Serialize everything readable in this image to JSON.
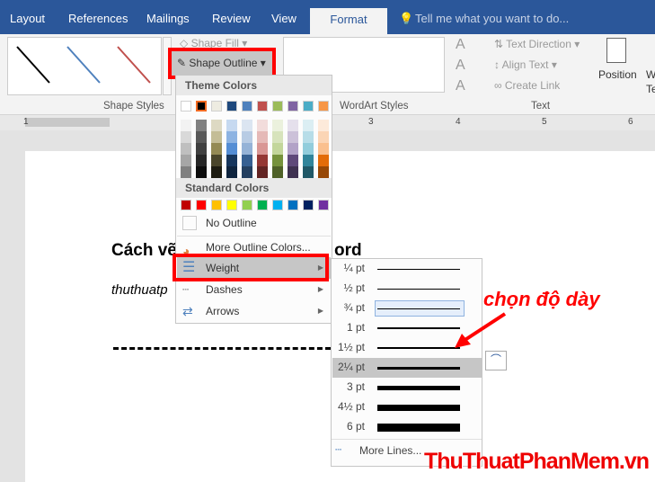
{
  "tabs": [
    "Layout",
    "References",
    "Mailings",
    "Review",
    "View",
    "Format"
  ],
  "tell_me": "Tell me what you want to do...",
  "ribbon": {
    "shape_fill": "Shape Fill",
    "shape_outline": "Shape Outline",
    "shape_styles": "Shape Styles",
    "wordart_styles": "WordArt Styles",
    "text_direction": "Text Direction",
    "align_text": "Align Text",
    "create_link": "Create Link",
    "text_group": "Text",
    "position": "Position",
    "wrap": "W",
    "wrap2": "Te"
  },
  "ruler": [
    "1",
    "3",
    "4",
    "5",
    "6"
  ],
  "document": {
    "heading_start": "Cách vẽ",
    "heading_end": "ord",
    "subtitle": "thuthuatp"
  },
  "menu": {
    "theme_colors": "Theme Colors",
    "standard_colors": "Standard Colors",
    "no_outline": "No Outline",
    "more_colors": "More Outline Colors...",
    "weight": "Weight",
    "dashes": "Dashes",
    "arrows": "Arrows"
  },
  "theme_colors": [
    "#ffffff",
    "#000000",
    "#eeece1",
    "#1f497d",
    "#4f81bd",
    "#c0504d",
    "#9bbb59",
    "#8064a2",
    "#4bacc6",
    "#f79646"
  ],
  "theme_shades": [
    [
      "#f2f2f2",
      "#d9d9d9",
      "#bfbfbf",
      "#a6a6a6",
      "#808080"
    ],
    [
      "#808080",
      "#595959",
      "#404040",
      "#262626",
      "#0d0d0d"
    ],
    [
      "#ddd9c3",
      "#c4bd97",
      "#948a54",
      "#4a452a",
      "#1d1b10"
    ],
    [
      "#c6d9f0",
      "#8db3e2",
      "#548dd4",
      "#17365d",
      "#0f243e"
    ],
    [
      "#dbe5f1",
      "#b8cce4",
      "#95b3d7",
      "#366092",
      "#244061"
    ],
    [
      "#f2dcdb",
      "#e5b9b7",
      "#d99694",
      "#953734",
      "#632423"
    ],
    [
      "#ebf1dd",
      "#d7e3bc",
      "#c3d69b",
      "#76923c",
      "#4f6128"
    ],
    [
      "#e5e0ec",
      "#ccc1d9",
      "#b2a2c7",
      "#5f497a",
      "#3f3151"
    ],
    [
      "#dbeef3",
      "#b7dde8",
      "#92cddc",
      "#31859b",
      "#205867"
    ],
    [
      "#fdeada",
      "#fbd5b5",
      "#fac08f",
      "#e36c09",
      "#974806"
    ]
  ],
  "standard_colors": [
    "#c00000",
    "#ff0000",
    "#ffc000",
    "#ffff00",
    "#92d050",
    "#00b050",
    "#00b0f0",
    "#0070c0",
    "#002060",
    "#7030a0"
  ],
  "weights": [
    {
      "label": "¼ pt",
      "pt": 0.25
    },
    {
      "label": "½ pt",
      "pt": 0.5
    },
    {
      "label": "¾ pt",
      "pt": 0.75
    },
    {
      "label": "1 pt",
      "pt": 1
    },
    {
      "label": "1½ pt",
      "pt": 1.5
    },
    {
      "label": "2¼ pt",
      "pt": 2.25
    },
    {
      "label": "3 pt",
      "pt": 3
    },
    {
      "label": "4½ pt",
      "pt": 4.5
    },
    {
      "label": "6 pt",
      "pt": 6
    }
  ],
  "weight_selected": "2¼ pt",
  "more_lines": "More Lines...",
  "annotation": "chọn độ dày",
  "watermark": "ThuThuatPhanMem.vn",
  "colors": {
    "accent": "#2b579a",
    "highlight": "#ff0000"
  }
}
